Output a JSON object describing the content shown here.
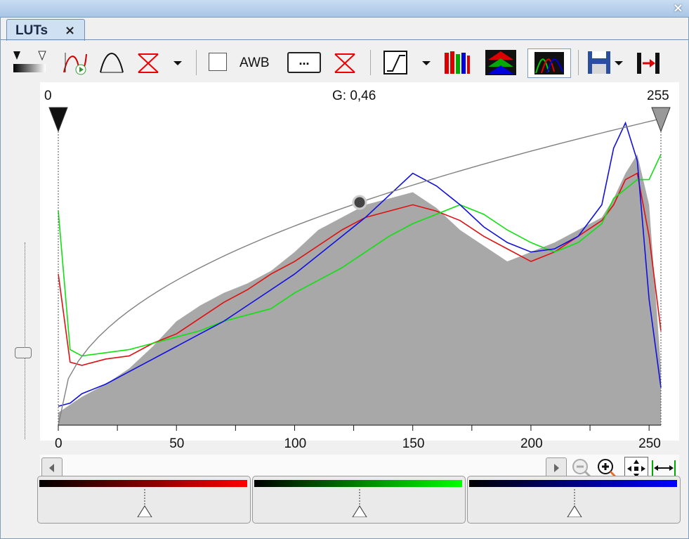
{
  "window": {
    "close_glyph": "×"
  },
  "tab": {
    "label": "LUTs",
    "close_glyph": "×"
  },
  "toolbar": {
    "awb_label": "AWB",
    "dots_label": "...",
    "icons": [
      "levels-icon",
      "curve-play-icon",
      "bell-curve-icon",
      "reset-red-icon",
      "dropdown-icon",
      "checkbox",
      "awb",
      "dots",
      "reset-red-icon-2",
      "gamma-curve-icon",
      "dropdown-icon-2",
      "rgb-bars-icon",
      "rgb-layers-icon",
      "rgb-histogram-icon",
      "save-icon",
      "apply-icon"
    ]
  },
  "chart": {
    "gamma_label": "G: 0,46",
    "left_value": "0",
    "right_value": "255",
    "x_ticks": [
      "0",
      "50",
      "100",
      "150",
      "200",
      "250"
    ],
    "colors": {
      "histogram": "#a8a8a8",
      "red": "#e01010",
      "green": "#10e010",
      "blue": "#1010e0",
      "curve": "#808080"
    }
  },
  "chart_data": {
    "type": "area",
    "x_range": [
      0,
      255
    ],
    "gamma": 0.46,
    "x_ticks": [
      0,
      50,
      100,
      150,
      200,
      250
    ],
    "black_point": 0,
    "white_point": 255,
    "grid": false,
    "series": [
      {
        "name": "gray",
        "x": [
          0,
          10,
          20,
          30,
          40,
          50,
          60,
          70,
          80,
          90,
          100,
          110,
          120,
          130,
          140,
          150,
          160,
          170,
          180,
          190,
          200,
          210,
          220,
          230,
          235,
          240,
          245,
          250,
          255
        ],
        "values": [
          4,
          9,
          13,
          18,
          25,
          33,
          38,
          42,
          45,
          49,
          55,
          62,
          66,
          70,
          72,
          74,
          69,
          62,
          57,
          52,
          55,
          58,
          62,
          66,
          72,
          80,
          86,
          70,
          18
        ]
      },
      {
        "name": "red",
        "x": [
          0,
          5,
          10,
          20,
          30,
          40,
          50,
          60,
          70,
          80,
          90,
          100,
          110,
          120,
          130,
          140,
          150,
          160,
          170,
          180,
          190,
          200,
          210,
          220,
          230,
          235,
          240,
          245,
          250,
          255
        ],
        "values": [
          48,
          20,
          19,
          21,
          22,
          26,
          29,
          34,
          39,
          43,
          48,
          52,
          57,
          62,
          66,
          68,
          70,
          68,
          65,
          60,
          56,
          52,
          55,
          60,
          65,
          70,
          78,
          80,
          60,
          30
        ]
      },
      {
        "name": "green",
        "x": [
          0,
          5,
          10,
          20,
          30,
          40,
          50,
          60,
          70,
          80,
          90,
          100,
          110,
          120,
          130,
          140,
          150,
          160,
          170,
          180,
          190,
          200,
          210,
          220,
          230,
          235,
          240,
          245,
          250,
          255
        ],
        "values": [
          68,
          24,
          22,
          23,
          24,
          26,
          28,
          30,
          33,
          35,
          37,
          42,
          46,
          50,
          55,
          60,
          64,
          67,
          70,
          67,
          62,
          58,
          55,
          58,
          64,
          72,
          75,
          78,
          78,
          86
        ]
      },
      {
        "name": "blue",
        "x": [
          0,
          5,
          10,
          20,
          30,
          40,
          50,
          60,
          70,
          80,
          90,
          100,
          110,
          120,
          130,
          140,
          150,
          160,
          170,
          180,
          190,
          200,
          210,
          220,
          230,
          235,
          240,
          245,
          250,
          255
        ],
        "values": [
          6,
          7,
          10,
          13,
          17,
          21,
          25,
          29,
          33,
          38,
          43,
          48,
          54,
          60,
          66,
          73,
          80,
          76,
          70,
          63,
          58,
          55,
          56,
          60,
          70,
          88,
          96,
          84,
          40,
          12
        ]
      }
    ]
  },
  "sliders": {
    "red": {
      "from": "#000000",
      "to": "#ff0000",
      "value": 0.5
    },
    "green": {
      "from": "#000000",
      "to": "#00ff00",
      "value": 0.5
    },
    "blue": {
      "from": "#000000",
      "to": "#0000ff",
      "value": 0.5
    }
  }
}
